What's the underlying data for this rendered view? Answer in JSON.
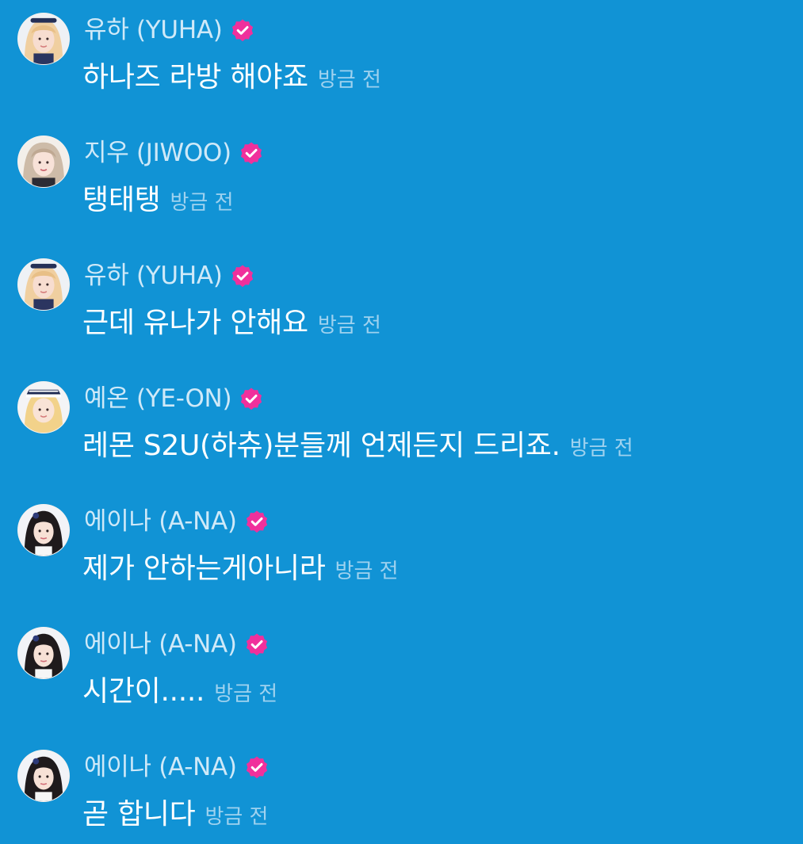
{
  "messages": [
    {
      "author": "유하 (YUHA)",
      "text": "하나즈 라방 해야죠",
      "time": "방금 전",
      "verified": true,
      "avatar_icon": "avatar-yuha",
      "avatar_hair": "#f0cfa0"
    },
    {
      "author": "지우 (JIWOO)",
      "text": "탱태탱",
      "time": "방금 전",
      "verified": true,
      "avatar_icon": "avatar-jiwoo",
      "avatar_hair": "#cdbba8"
    },
    {
      "author": "유하 (YUHA)",
      "text": "근데 유나가 안해요",
      "time": "방금 전",
      "verified": true,
      "avatar_icon": "avatar-yuha",
      "avatar_hair": "#f0cfa0"
    },
    {
      "author": "예온 (YE-ON)",
      "text": "레몬 S2U(하츄)분들께 언제든지 드리죠.",
      "time": "방금 전",
      "verified": true,
      "avatar_icon": "avatar-yeon",
      "avatar_hair": "#f2d28a"
    },
    {
      "author": "에이나 (A-NA)",
      "text": "제가 안하는게아니라",
      "time": "방금 전",
      "verified": true,
      "avatar_icon": "avatar-ana",
      "avatar_hair": "#1f1a1c"
    },
    {
      "author": "에이나 (A-NA)",
      "text": "시간이.....",
      "time": "방금 전",
      "verified": true,
      "avatar_icon": "avatar-ana",
      "avatar_hair": "#1f1a1c"
    },
    {
      "author": "에이나 (A-NA)",
      "text": "곧 합니다",
      "time": "방금 전",
      "verified": true,
      "avatar_icon": "avatar-ana",
      "avatar_hair": "#1f1a1c"
    }
  ],
  "colors": {
    "background": "#1193d5",
    "name_text": "#cfe9f8",
    "message_text": "#ffffff",
    "time_text": "#9fd2ef",
    "verified_badge": "#f0309c"
  }
}
